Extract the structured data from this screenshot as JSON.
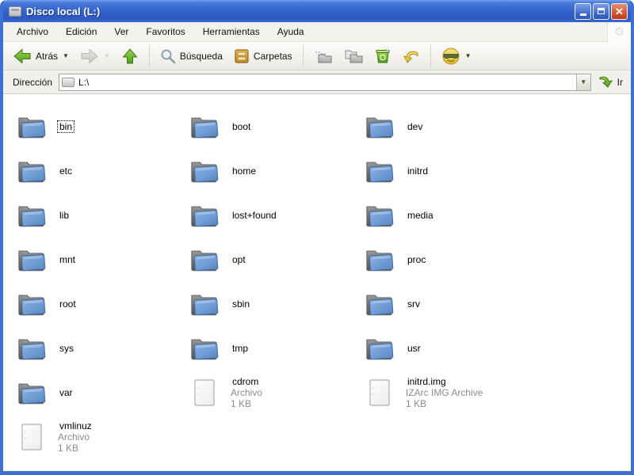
{
  "window": {
    "title": "Disco local (L:)",
    "controls": {
      "minimize": "minimize",
      "maximize": "maximize",
      "close": "x"
    }
  },
  "menu": {
    "items": [
      "Archivo",
      "Edición",
      "Ver",
      "Favoritos",
      "Herramientas",
      "Ayuda"
    ]
  },
  "toolbar": {
    "back_label": "Atrás",
    "search_label": "Búsqueda",
    "folders_label": "Carpetas"
  },
  "address": {
    "label": "Dirección",
    "value": "L:\\",
    "go_label": "Ir"
  },
  "colors": {
    "titlebar_blue": "#3465cd",
    "close_red": "#d4502f",
    "folder_front_blue": "#6f9cd4",
    "folders_button_amber": "#d9a33c",
    "arrow_green": "#56a623"
  },
  "files": {
    "items": [
      {
        "name": "bin",
        "type": "folder",
        "selected": true
      },
      {
        "name": "boot",
        "type": "folder"
      },
      {
        "name": "dev",
        "type": "folder"
      },
      {
        "name": "etc",
        "type": "folder"
      },
      {
        "name": "home",
        "type": "folder"
      },
      {
        "name": "initrd",
        "type": "folder"
      },
      {
        "name": "lib",
        "type": "folder"
      },
      {
        "name": "lost+found",
        "type": "folder"
      },
      {
        "name": "media",
        "type": "folder"
      },
      {
        "name": "mnt",
        "type": "folder"
      },
      {
        "name": "opt",
        "type": "folder"
      },
      {
        "name": "proc",
        "type": "folder"
      },
      {
        "name": "root",
        "type": "folder"
      },
      {
        "name": "sbin",
        "type": "folder"
      },
      {
        "name": "srv",
        "type": "folder"
      },
      {
        "name": "sys",
        "type": "folder"
      },
      {
        "name": "tmp",
        "type": "folder"
      },
      {
        "name": "usr",
        "type": "folder"
      },
      {
        "name": "var",
        "type": "folder"
      },
      {
        "name": "cdrom",
        "type": "file",
        "kind": "Archivo",
        "size": "1 KB"
      },
      {
        "name": "initrd.img",
        "type": "file",
        "kind": "IZArc IMG Archive",
        "size": "1 KB"
      },
      {
        "name": "vmlinuz",
        "type": "file",
        "kind": "Archivo",
        "size": "1 KB"
      }
    ]
  }
}
